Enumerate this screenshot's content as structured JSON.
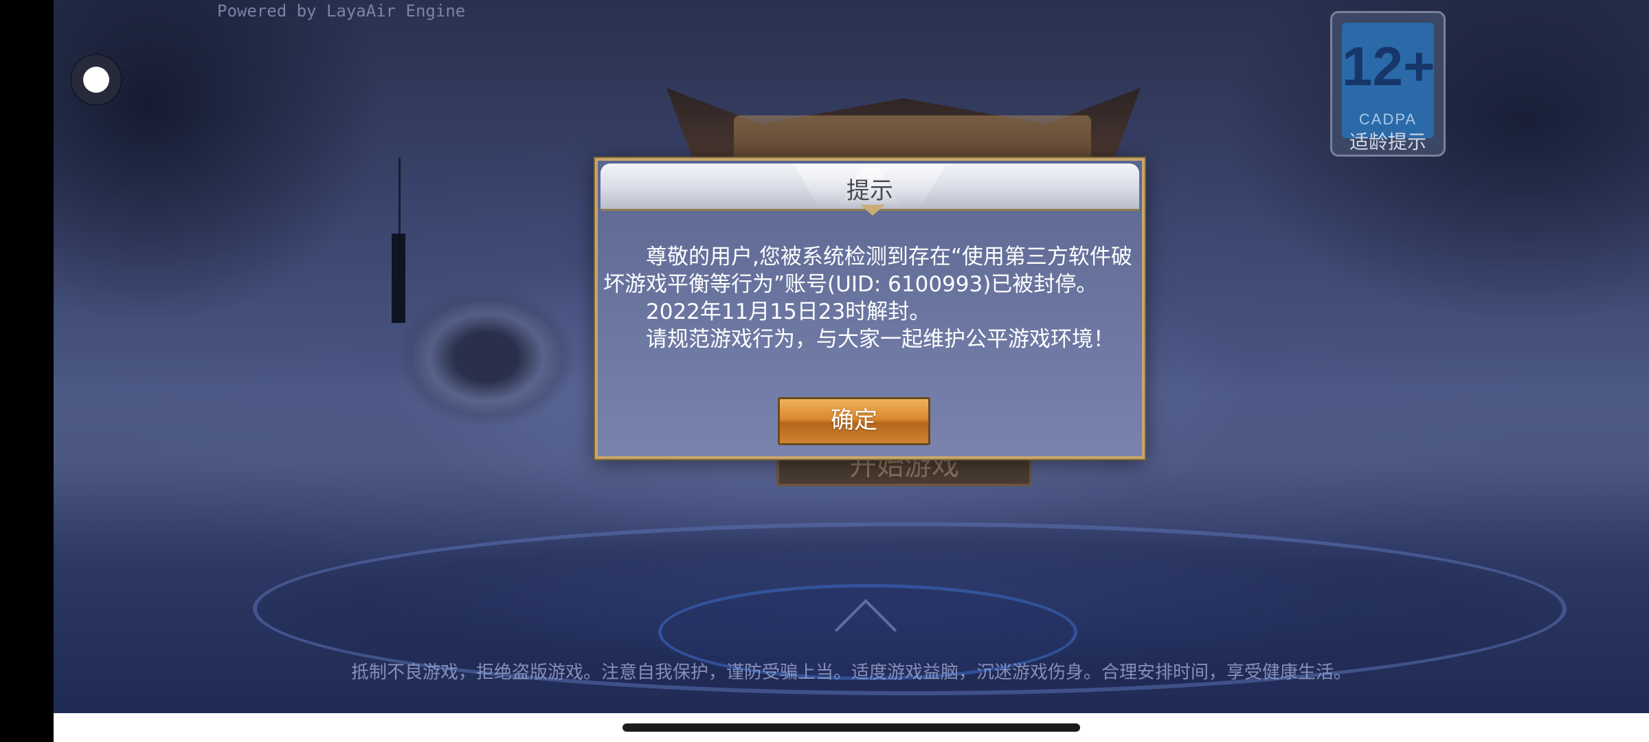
{
  "engine": {
    "powered_by": "Powered by LayaAir Engine"
  },
  "age_rating": {
    "number": "12+",
    "org": "CADPA",
    "label": "适龄提示"
  },
  "background_button": {
    "label": "开始游戏"
  },
  "dialog": {
    "title": "提示",
    "paragraph_1": "尊敬的用户,您被系统检测到存在“使用第三方软件破坏游戏平衡等行为”账号(UID: 6100993)已被封停。",
    "paragraph_2": "2022年11月15日23时解封。",
    "paragraph_3": "请规范游戏行为，与大家一起维护公平游戏环境！",
    "confirm_label": "确定"
  },
  "footer": {
    "health_notice": "抵制不良游戏，拒绝盗版游戏。注意自我保护，谨防受骗上当。适度游戏益脑，沉迷游戏伤身。合理安排时间，享受健康生活。"
  }
}
